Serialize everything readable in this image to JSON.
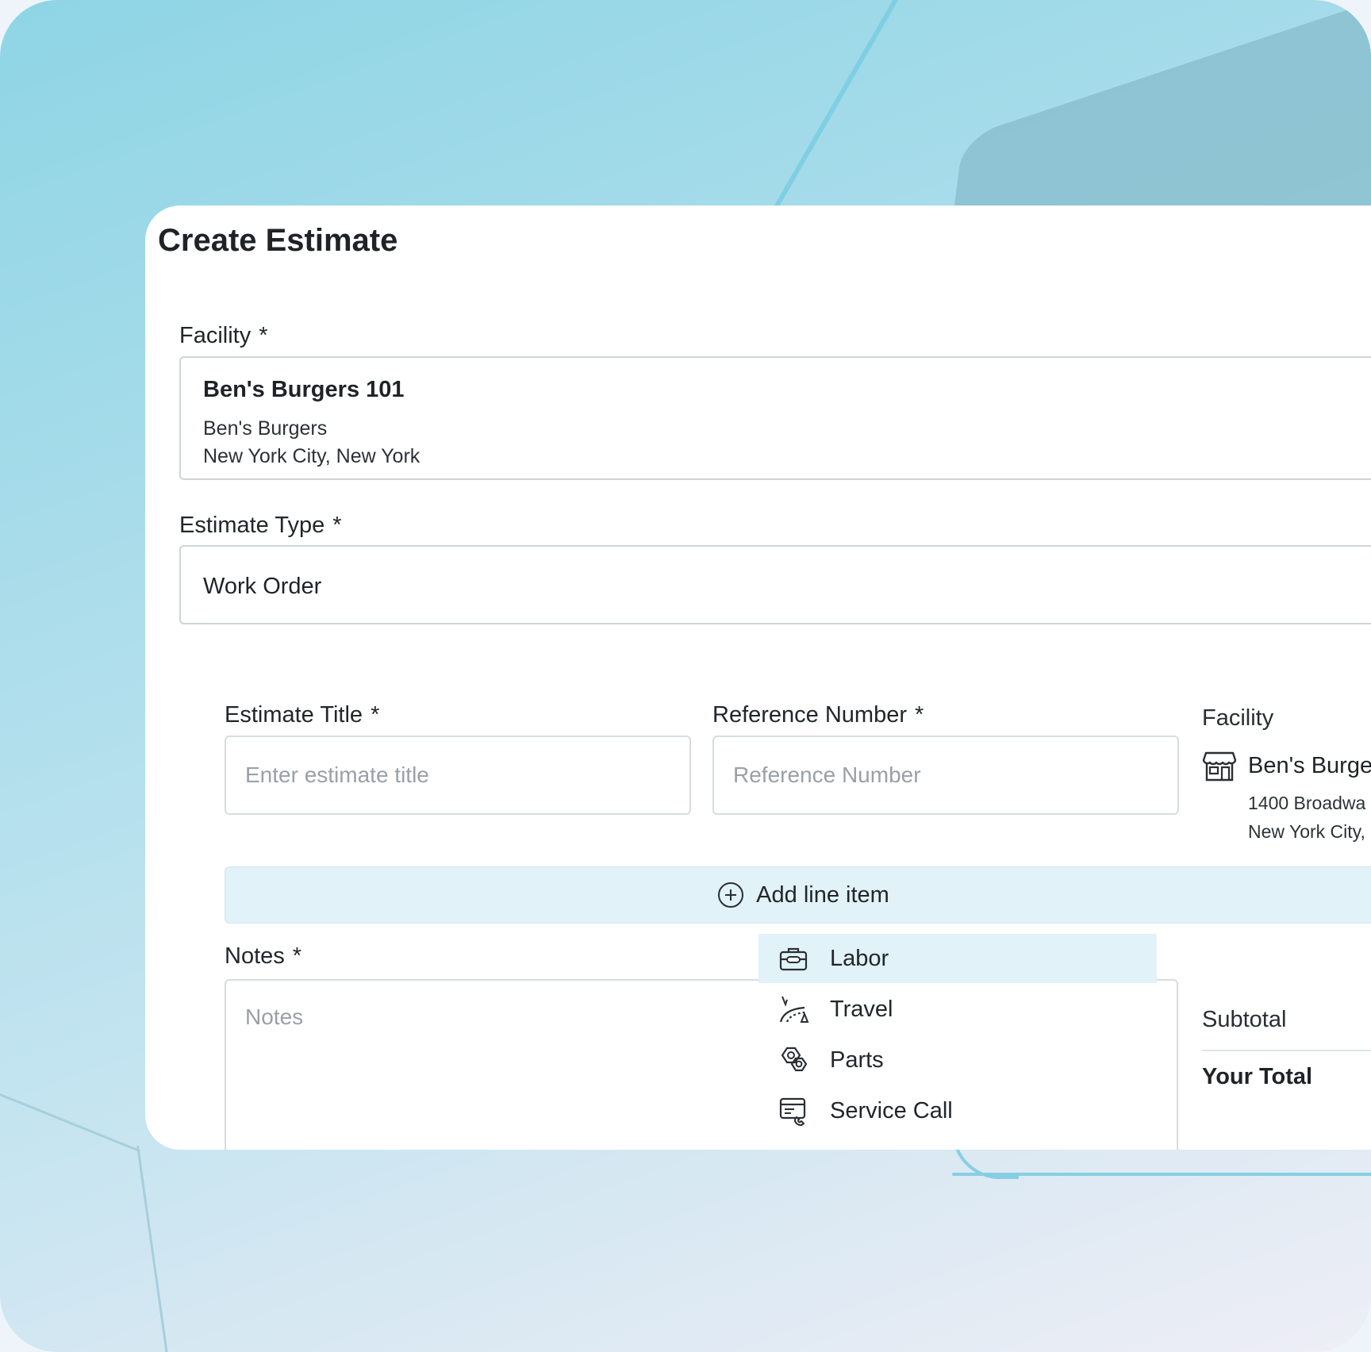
{
  "page": {
    "title": "Create Estimate"
  },
  "facility_field": {
    "label": "Facility",
    "required_mark": "*",
    "name": "Ben's Burgers 101",
    "company": "Ben's Burgers",
    "location": "New York City, New York"
  },
  "estimate_type": {
    "label": "Estimate Type",
    "required_mark": "*",
    "value": "Work Order"
  },
  "estimate_title": {
    "label": "Estimate Title",
    "required_mark": "*",
    "placeholder": "Enter estimate title"
  },
  "reference_number": {
    "label": "Reference Number",
    "required_mark": "*",
    "placeholder": "Reference Number"
  },
  "side_facility": {
    "label": "Facility",
    "name": "Ben's Burge",
    "address": "1400 Broadwa",
    "city": "New York City,",
    "icon": "store-icon"
  },
  "add_line_item": {
    "label": "Add line item",
    "icon": "plus-circle-icon"
  },
  "notes": {
    "label": "Notes",
    "required_mark": "*",
    "placeholder": "Notes"
  },
  "line_item_menu": {
    "items": [
      {
        "label": "Labor",
        "icon": "toolbox-icon",
        "highlighted": true
      },
      {
        "label": "Travel",
        "icon": "road-icon",
        "highlighted": false
      },
      {
        "label": "Parts",
        "icon": "parts-icon",
        "highlighted": false
      },
      {
        "label": "Service Call",
        "icon": "service-call-icon",
        "highlighted": false
      }
    ]
  },
  "totals": {
    "subtotal_label": "Subtotal",
    "total_label": "Your Total"
  },
  "colors": {
    "highlight": "#e1f2f8",
    "border": "#cfd4d9",
    "text": "#1f2328",
    "placeholder": "#9aa0a6"
  }
}
